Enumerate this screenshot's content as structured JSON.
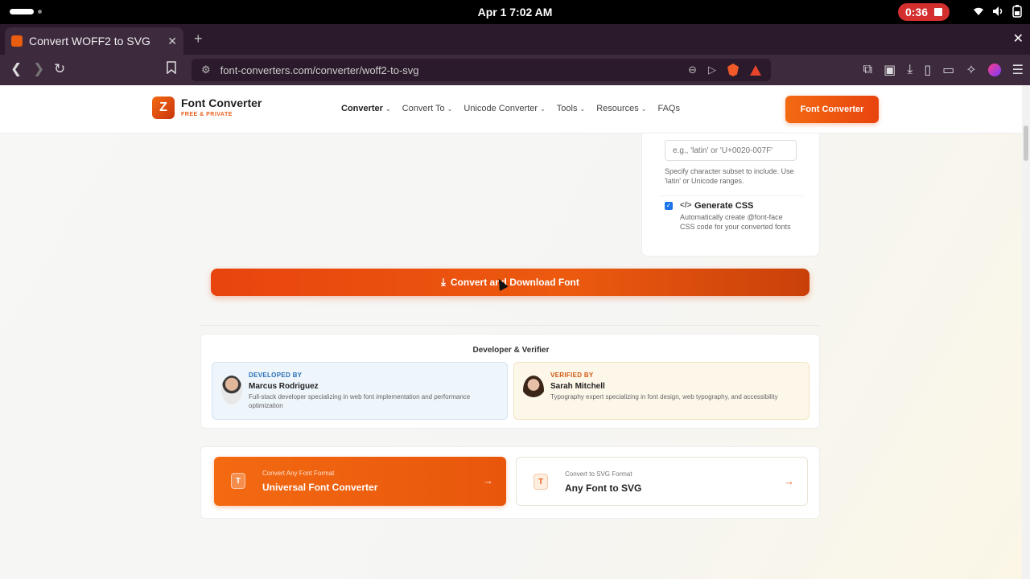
{
  "status_bar": {
    "clock": "Apr 1   7:02 AM",
    "recording_time": "0:36"
  },
  "browser": {
    "tab_title": "Convert WOFF2 to SVG",
    "url": "font-converters.com/converter/woff2-to-svg"
  },
  "site": {
    "logo_mark": "Z",
    "logo_name": "Font Converter",
    "logo_tagline": "FREE & PRIVATE",
    "nav": [
      {
        "label": "Converter",
        "has_dropdown": true
      },
      {
        "label": "Convert To",
        "has_dropdown": true
      },
      {
        "label": "Unicode Converter",
        "has_dropdown": true
      },
      {
        "label": "Tools",
        "has_dropdown": true
      },
      {
        "label": "Resources",
        "has_dropdown": true
      },
      {
        "label": "FAQs",
        "has_dropdown": false
      }
    ],
    "header_cta": "Font Converter"
  },
  "options": {
    "subset_placeholder": "e.g., 'latin' or 'U+0020-007F'",
    "subset_help": "Specify character subset to include. Use 'latin' or Unicode ranges.",
    "generate_css_label": "Generate CSS",
    "generate_css_checked": true,
    "generate_css_desc": "Automatically create @font-face CSS code for your converted fonts"
  },
  "convert_button": "Convert and Download Font",
  "credits": {
    "title": "Developer & Verifier",
    "developer": {
      "role": "DEVELOPED BY",
      "name": "Marcus Rodriguez",
      "desc": "Full-stack developer specializing in web font implementation and performance optimization"
    },
    "verifier": {
      "role": "VERIFIED BY",
      "name": "Sarah Mitchell",
      "desc": "Typography expert specializing in font design, web typography, and accessibility"
    }
  },
  "related_links": [
    {
      "subtitle": "Convert Any Font Format",
      "title": "Universal Font Converter"
    },
    {
      "subtitle": "Convert to SVG Format",
      "title": "Any Font to SVG"
    }
  ],
  "colors": {
    "brand_orange": "#f36a12",
    "convert_red": "#e8440e",
    "checkbox_blue": "#1a73e8",
    "recording_red": "#d32f2f"
  }
}
